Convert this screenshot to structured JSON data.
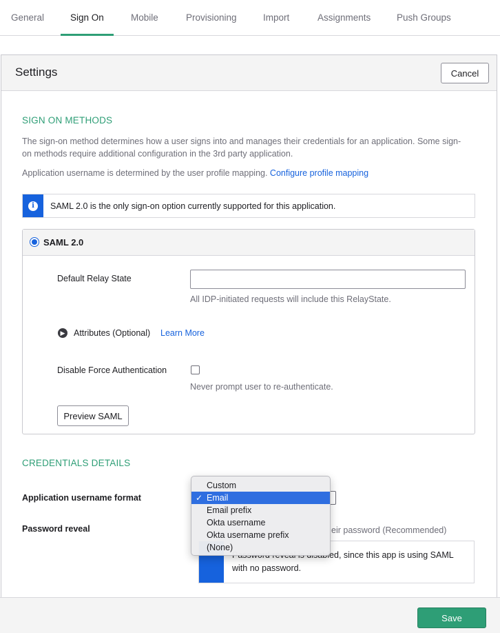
{
  "tabs": [
    {
      "label": "General"
    },
    {
      "label": "Sign On"
    },
    {
      "label": "Mobile"
    },
    {
      "label": "Provisioning"
    },
    {
      "label": "Import"
    },
    {
      "label": "Assignments"
    },
    {
      "label": "Push Groups"
    }
  ],
  "settings": {
    "title": "Settings",
    "cancel_label": "Cancel"
  },
  "sign_on": {
    "section_title": "SIGN ON METHODS",
    "description_line1": "The sign-on method determines how a user signs into and manages their credentials for an application. Some sign-",
    "description_line2": "on methods require additional configuration in the 3rd party application.",
    "mapping_text": "Application username is determined by the user profile mapping. ",
    "mapping_link": "Configure profile mapping",
    "info_text": "SAML 2.0 is the only sign-on option currently supported for this application."
  },
  "saml": {
    "label": "SAML 2.0",
    "relay_label": "Default Relay State",
    "relay_value": "",
    "relay_help": "All IDP-initiated requests will include this RelayState.",
    "attributes_label": "Attributes (Optional)",
    "learn_more": "Learn More",
    "disable_force_label": "Disable Force Authentication",
    "disable_force_checked": false,
    "disable_force_help": "Never prompt user to re-authenticate.",
    "preview_label": "Preview SAML"
  },
  "credentials": {
    "section_title": "CREDENTIALS DETAILS",
    "username_format_label": "Application username format",
    "password_reveal_label": "Password reveal",
    "password_reveal_help_fragment": "eir password (Recommended)",
    "reveal_info_line1": "Password reveal is disabled, since this app is using SAML",
    "reveal_info_line2": "with no password.",
    "dropdown_options": [
      "Custom",
      "Email",
      "Email prefix",
      "Okta username",
      "Okta username prefix",
      "(None)"
    ],
    "selected_option": "Email"
  },
  "footer": {
    "save_label": "Save"
  },
  "colors": {
    "accent": "#2e9e76",
    "link": "#1662dd",
    "selection": "#2f6ee0"
  }
}
